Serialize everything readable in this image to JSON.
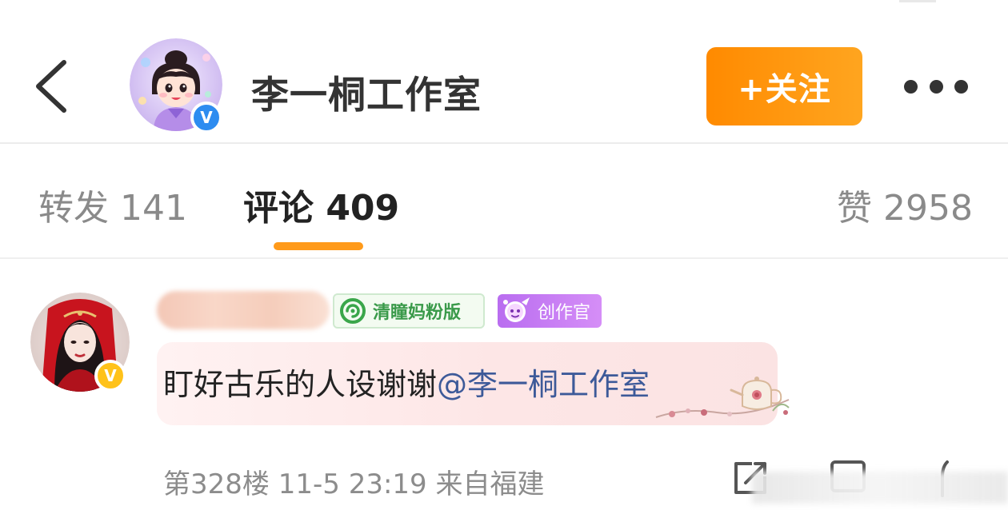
{
  "header": {
    "back_icon": "chevron-left-icon",
    "avatar_icon": "cartoon-avatar-icon",
    "verified_icon": "verified-v-icon",
    "verified_mark": "V",
    "name": "李一桐工作室",
    "follow_label": "+关注",
    "more_icon": "more-dots-icon",
    "accent_color": "#ff8a00"
  },
  "tabs": {
    "repost_label": "转发 141",
    "comments_label": "评论 409",
    "likes_label": "赞 2958",
    "active": "comments",
    "active_color": "#ff9a1a"
  },
  "comment": {
    "avatar_icon": "user-photo-avatar-icon",
    "verified_mark": "V",
    "verified_color": "#ffc21a",
    "fan_badge_label": "清瞳妈粉版",
    "fan_badge_icon": "lollipop-icon",
    "creator_badge_label": "创作官",
    "creator_badge_icon": "creator-mascot-icon",
    "text": "盯好古乐的人设谢谢",
    "mention": "@李一桐工作室",
    "mention_color": "#3d5a99",
    "floor": "第328楼",
    "time": "11-5 23:19",
    "location": "来自福建",
    "actions": [
      "share-icon",
      "comment-icon",
      "like-icon"
    ]
  }
}
